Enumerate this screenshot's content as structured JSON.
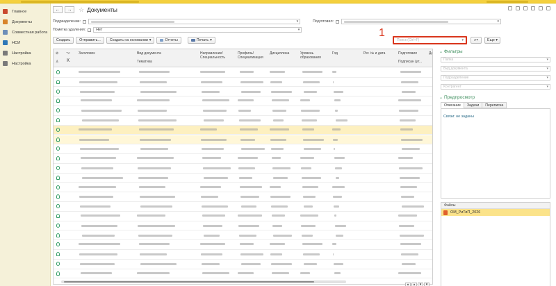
{
  "sidebar": {
    "items": [
      {
        "label": "Главное",
        "icon": "home-icon"
      },
      {
        "label": "Документы",
        "icon": "documents-icon"
      },
      {
        "label": "Совместная работа",
        "icon": "collaboration-icon"
      },
      {
        "label": "НСИ",
        "icon": "reference-data-icon"
      },
      {
        "label": "Настройка",
        "icon": "settings-icon"
      },
      {
        "label": "Настройка",
        "icon": "gear-icon"
      }
    ]
  },
  "window": {
    "title": "Документы",
    "back": "←",
    "forward": "→",
    "star": "☆"
  },
  "filters": {
    "podrazdelenie_label": "Подразделение:",
    "podgotovil_label": "Подготовил:",
    "pometka_label": "Пометка удаления:",
    "pometka_value": "Нет"
  },
  "toolbar": {
    "create": "Создать",
    "send": "Отправить...",
    "create_based": "Создать на основании",
    "reports": "Отчеты",
    "print": "Печать"
  },
  "search": {
    "placeholder": "Поиск (Ctrl+F)",
    "marker": "1",
    "more": "Еще"
  },
  "table": {
    "headers": {
      "title": "Заголовок",
      "k": "К",
      "doc_type": "Вид документа",
      "theme": "Тематика",
      "direction": "Направление/Специальность",
      "profile": "Профиль/Специализация",
      "discipline": "Дисциплина",
      "level": "Уровень образования",
      "year": "Год",
      "reg": "Рег. № и дата",
      "prepared": "Подготовил",
      "signed": "Подписан (ут...",
      "da": "Да"
    }
  },
  "right_panel": {
    "filters_title": "Фильтры",
    "filter_fields": [
      "Папка",
      "Вид документа",
      "Подразделение",
      "Контрагент"
    ],
    "preview_title": "Предпросмотр",
    "tabs": [
      "Описание",
      "Задачи",
      "Переписка"
    ],
    "links_text": "Связи: не заданы",
    "files_header": "Файлы",
    "file_name": "ОМ_РиТиП_2026"
  },
  "colors": {
    "accent_red": "#d9351c",
    "section_green": "#3a8c5a",
    "row_highlight": "#fdf0c0",
    "sidebar_bg": "#f5f1d9"
  }
}
